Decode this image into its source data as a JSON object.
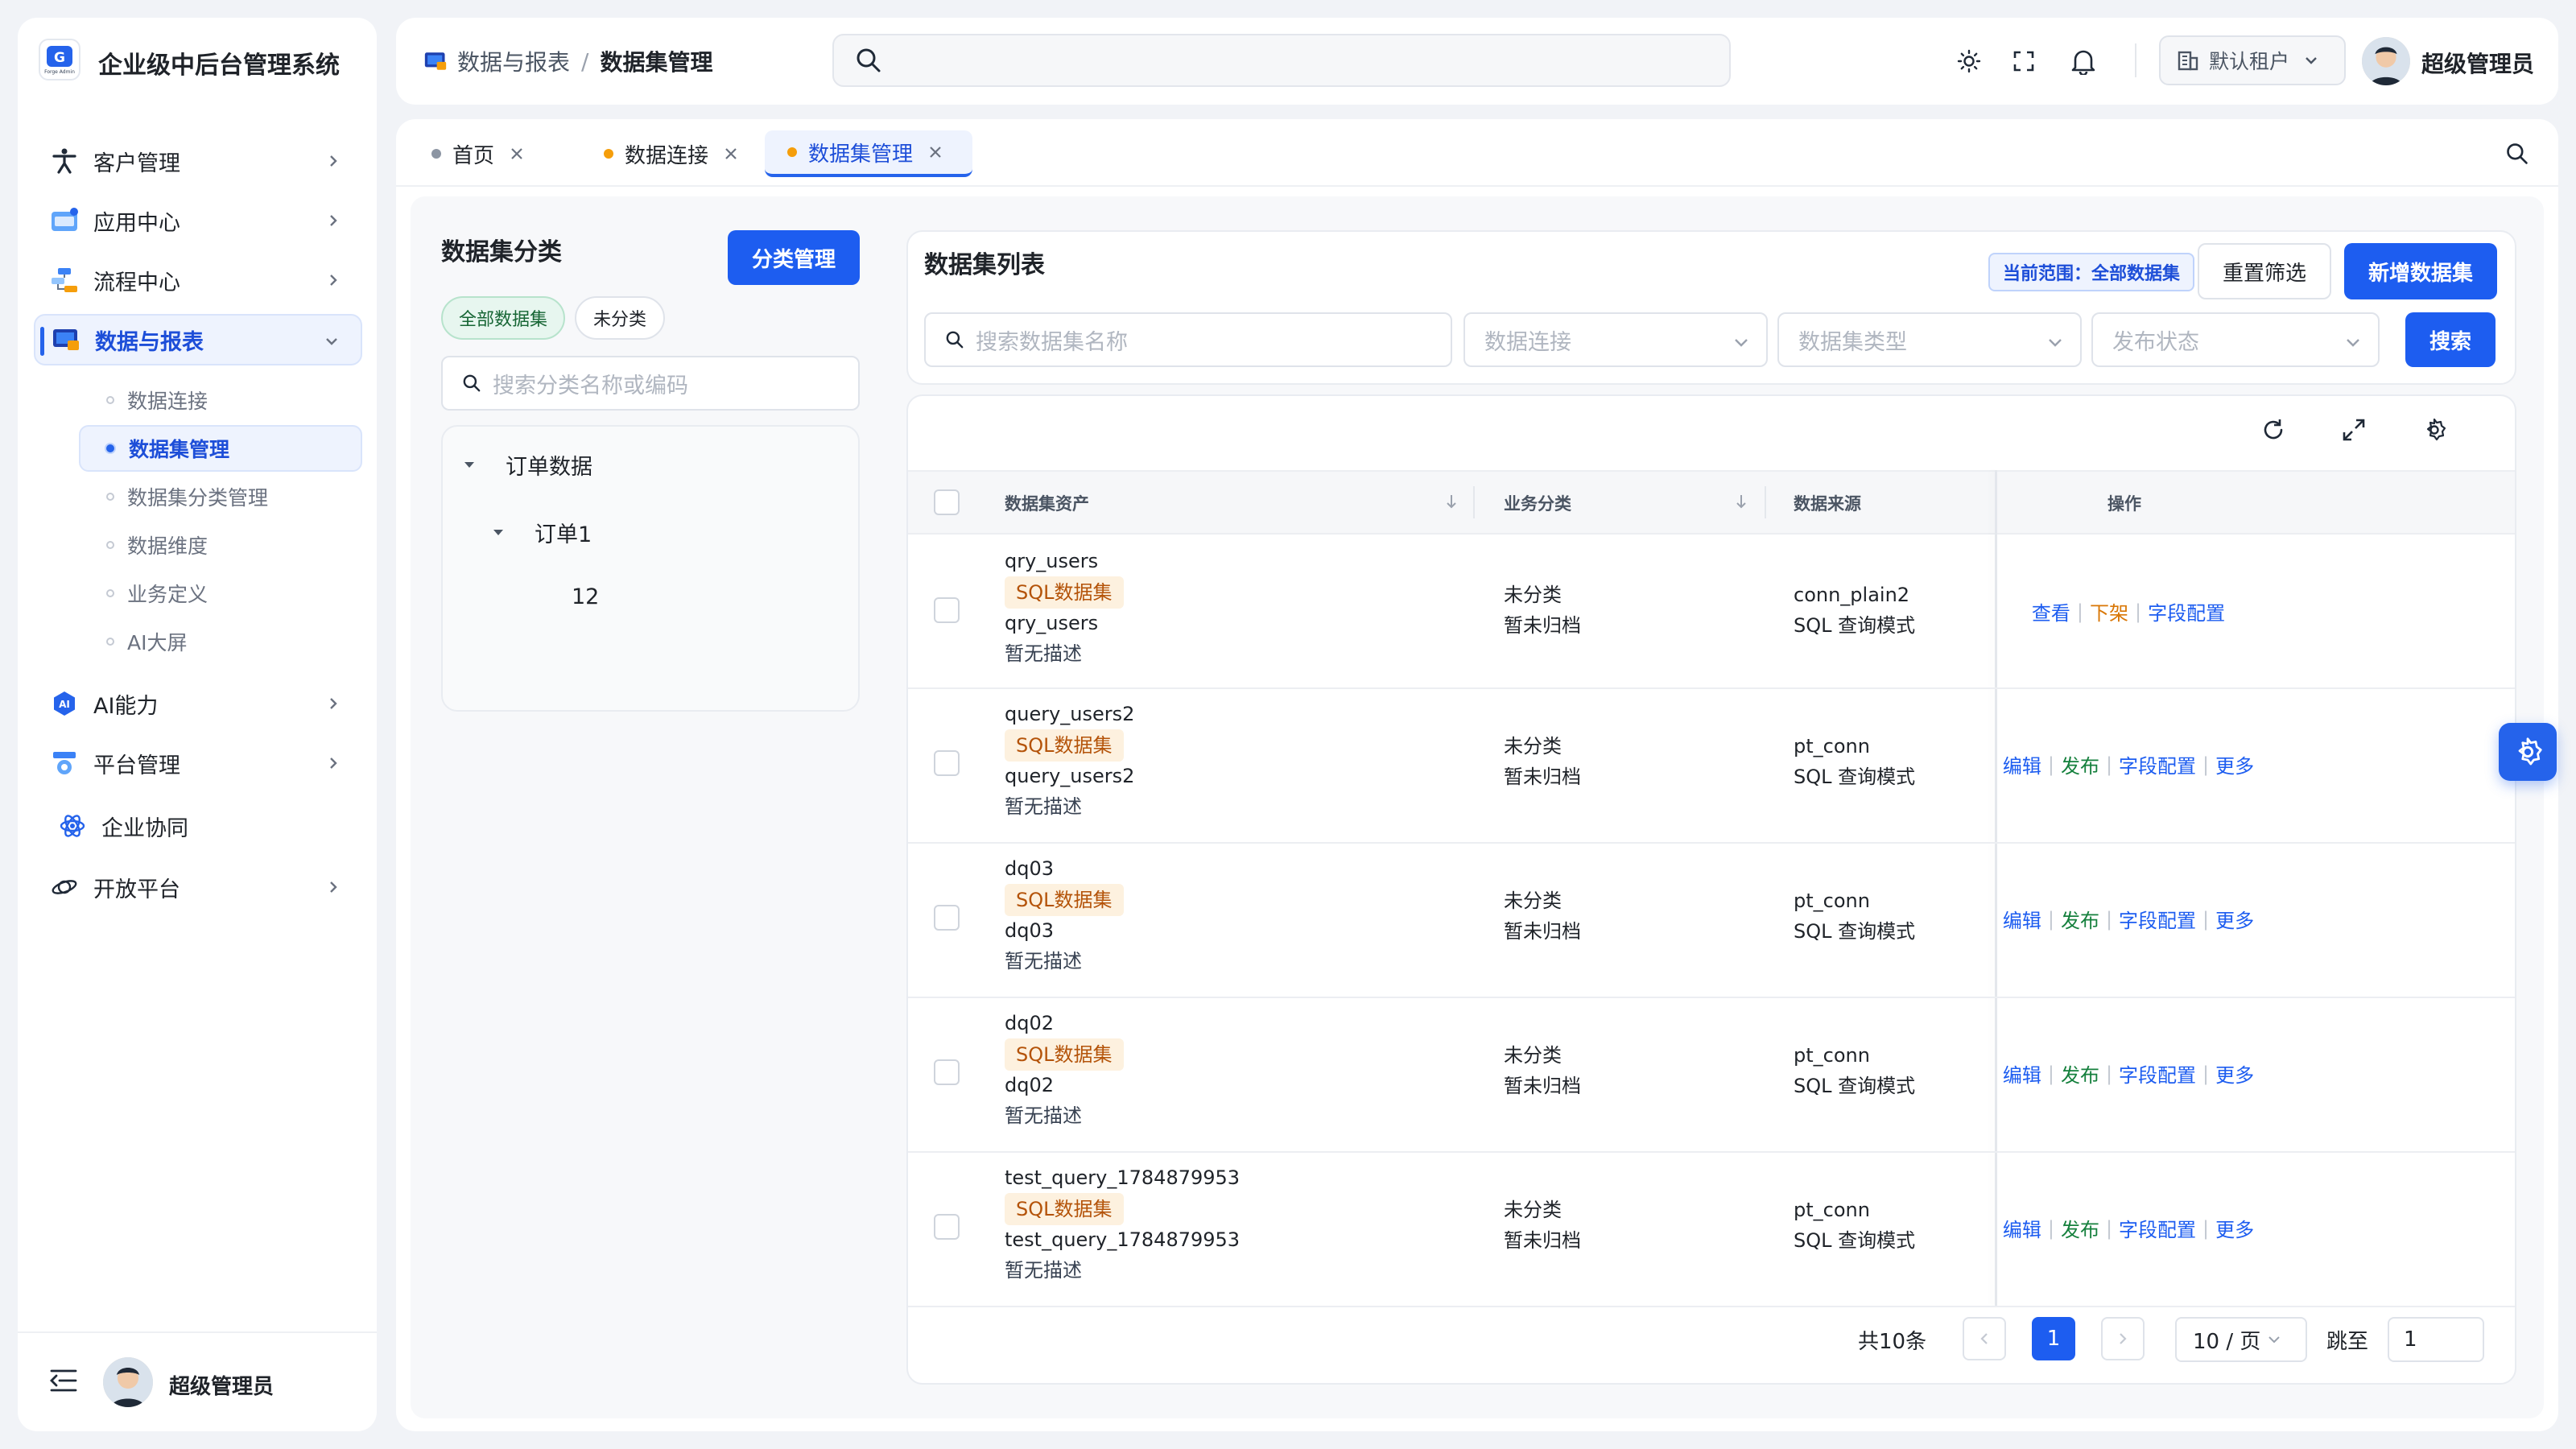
{
  "app": {
    "title": "企业级中后台管理系统",
    "logo_text": "Forge Admin"
  },
  "sidebar": {
    "items": [
      {
        "label": "客户管理",
        "icon": "accessibility-icon"
      },
      {
        "label": "应用中心",
        "icon": "app-center-icon"
      },
      {
        "label": "流程中心",
        "icon": "flow-icon"
      },
      {
        "label": "数据与报表",
        "icon": "data-report-icon"
      },
      {
        "label": "AI能力",
        "icon": "ai-icon"
      },
      {
        "label": "平台管理",
        "icon": "platform-icon"
      },
      {
        "label": "企业协同",
        "icon": "collab-icon"
      },
      {
        "label": "开放平台",
        "icon": "open-platform-icon"
      }
    ],
    "sub_items": [
      "数据连接",
      "数据集管理",
      "数据集分类管理",
      "数据维度",
      "业务定义",
      "AI大屏"
    ],
    "user_name": "超级管理员"
  },
  "header": {
    "breadcrumb": [
      "数据与报表",
      "数据集管理"
    ],
    "breadcrumb_sep": "/",
    "search_placeholder": "",
    "tenant": "默认租户",
    "user_name": "超级管理员"
  },
  "tabs": [
    {
      "label": "首页",
      "dot_color": "#8c95a3"
    },
    {
      "label": "数据连接",
      "dot_color": "#f59e0b"
    },
    {
      "label": "数据集管理",
      "dot_color": "#f59e0b"
    }
  ],
  "category_panel": {
    "title": "数据集分类",
    "manage_button": "分类管理",
    "chips": [
      "全部数据集",
      "未分类"
    ],
    "search_placeholder": "搜索分类名称或编码",
    "tree": [
      {
        "label": "订单数据",
        "level": 0,
        "expanded": true
      },
      {
        "label": "订单1",
        "level": 1,
        "expanded": true
      },
      {
        "label": "12",
        "level": 2,
        "expanded": false
      }
    ]
  },
  "list_panel": {
    "title": "数据集列表",
    "scope_badge": "当前范围：全部数据集",
    "reset_button": "重置筛选",
    "new_button": "新增数据集",
    "search_placeholder": "搜索数据集名称",
    "filters": [
      "数据连接",
      "数据集类型",
      "发布状态"
    ],
    "search_button": "搜索"
  },
  "table": {
    "columns": [
      "数据集资产",
      "业务分类",
      "数据来源",
      "操作"
    ],
    "rows": [
      {
        "name": "qry_users",
        "tag": "SQL数据集",
        "code": "qry_users",
        "desc": "暂无描述",
        "category": "未分类",
        "archive": "暂未归档",
        "conn": "conn_plain2",
        "mode": "SQL 查询模式",
        "ops": [
          {
            "label": "查看",
            "color": "blue"
          },
          {
            "label": "下架",
            "color": "orange"
          },
          {
            "label": "字段配置",
            "color": "blue"
          }
        ]
      },
      {
        "name": "query_users2",
        "tag": "SQL数据集",
        "code": "query_users2",
        "desc": "暂无描述",
        "category": "未分类",
        "archive": "暂未归档",
        "conn": "pt_conn",
        "mode": "SQL 查询模式",
        "ops": [
          {
            "label": "编辑",
            "color": "blue"
          },
          {
            "label": "发布",
            "color": "green"
          },
          {
            "label": "字段配置",
            "color": "blue"
          },
          {
            "label": "更多",
            "color": "blue"
          }
        ]
      },
      {
        "name": "dq03",
        "tag": "SQL数据集",
        "code": "dq03",
        "desc": "暂无描述",
        "category": "未分类",
        "archive": "暂未归档",
        "conn": "pt_conn",
        "mode": "SQL 查询模式",
        "ops": [
          {
            "label": "编辑",
            "color": "blue"
          },
          {
            "label": "发布",
            "color": "green"
          },
          {
            "label": "字段配置",
            "color": "blue"
          },
          {
            "label": "更多",
            "color": "blue"
          }
        ]
      },
      {
        "name": "dq02",
        "tag": "SQL数据集",
        "code": "dq02",
        "desc": "暂无描述",
        "category": "未分类",
        "archive": "暂未归档",
        "conn": "pt_conn",
        "mode": "SQL 查询模式",
        "ops": [
          {
            "label": "编辑",
            "color": "blue"
          },
          {
            "label": "发布",
            "color": "green"
          },
          {
            "label": "字段配置",
            "color": "blue"
          },
          {
            "label": "更多",
            "color": "blue"
          }
        ]
      },
      {
        "name": "test_query_1784879953",
        "tag": "SQL数据集",
        "code": "test_query_1784879953",
        "desc": "暂无描述",
        "category": "未分类",
        "archive": "暂未归档",
        "conn": "pt_conn",
        "mode": "SQL 查询模式",
        "ops": [
          {
            "label": "编辑",
            "color": "blue"
          },
          {
            "label": "发布",
            "color": "green"
          },
          {
            "label": "字段配置",
            "color": "blue"
          },
          {
            "label": "更多",
            "color": "blue"
          }
        ]
      }
    ]
  },
  "pagination": {
    "total": "共10条",
    "current_page": "1",
    "page_size": "10 / 页",
    "jump_label": "跳至",
    "jump_value": "1"
  },
  "colors": {
    "primary": "#1d5df0",
    "accent_orange": "#d97706",
    "accent_green": "#15803d"
  }
}
